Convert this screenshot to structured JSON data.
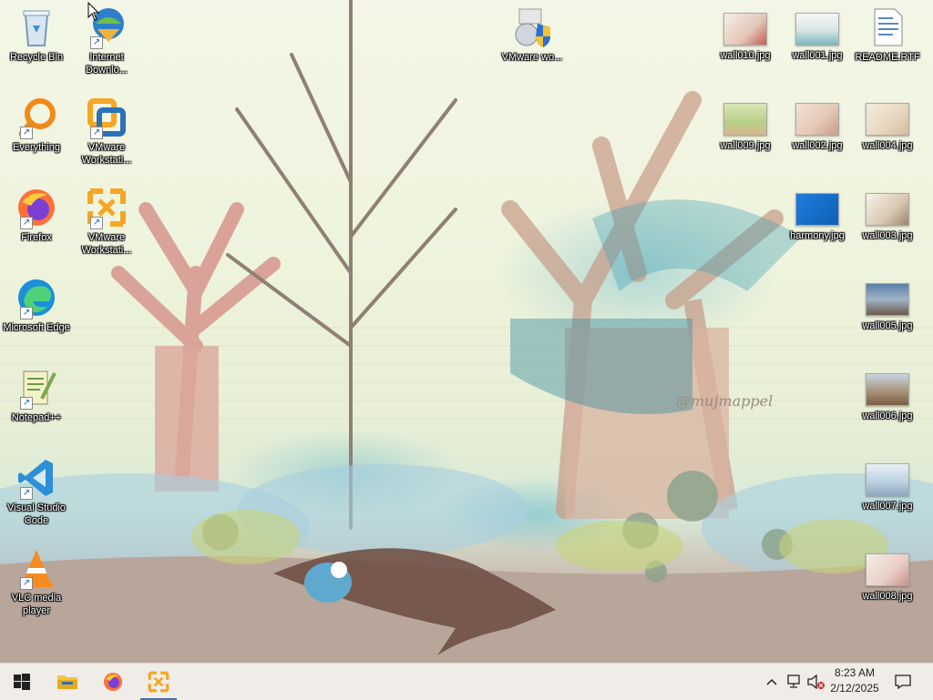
{
  "desktop": {
    "left_icons": [
      {
        "name": "recycle-bin",
        "label": "Recycle Bin"
      },
      {
        "name": "internet-download-manager",
        "label": "Internet Downlo..."
      },
      {
        "name": "everything",
        "label": "Everything"
      },
      {
        "name": "vmware-workstation-1",
        "label": "VMware Workstati..."
      },
      {
        "name": "firefox",
        "label": "Firefox"
      },
      {
        "name": "vmware-workstation-2",
        "label": "VMware Workstati..."
      },
      {
        "name": "microsoft-edge",
        "label": "Microsoft Edge"
      },
      {
        "name": "notepad-plus-plus",
        "label": "Notepad++"
      },
      {
        "name": "visual-studio-code",
        "label": "Visual Studio Code"
      },
      {
        "name": "vlc-media-player",
        "label": "VLC media player"
      }
    ],
    "center_icon": {
      "name": "vmware-wo",
      "label": "VMware wo..."
    },
    "right_icons": [
      {
        "name": "wall010",
        "label": "wall010.jpg"
      },
      {
        "name": "wall001",
        "label": "wall001.jpg"
      },
      {
        "name": "readme",
        "label": "README.RTF"
      },
      {
        "name": "wall009",
        "label": "wall009.jpg"
      },
      {
        "name": "wall002",
        "label": "wall002.jpg"
      },
      {
        "name": "wall004",
        "label": "wall004.jpg"
      },
      {
        "name": "harmony",
        "label": "harmony.jpg"
      },
      {
        "name": "wall003",
        "label": "wall003.jpg"
      },
      {
        "name": "wall005",
        "label": "wall005.jpg"
      },
      {
        "name": "wall006",
        "label": "wall006.jpg"
      },
      {
        "name": "wall007",
        "label": "wall007.jpg"
      },
      {
        "name": "wall008",
        "label": "wall008.jpg"
      }
    ],
    "wallpaper_signature": "@mujmappel"
  },
  "taskbar": {
    "start_icon": "windows-logo-icon",
    "pinned": [
      "file-explorer-icon",
      "firefox-icon",
      "vmware-icon"
    ],
    "tray_icons": [
      "chevron-up-icon",
      "network-icon",
      "volume-muted-icon",
      "notification-icon"
    ],
    "clock": {
      "time": "8:23 AM",
      "date": "2/12/2025"
    }
  },
  "colors": {
    "taskbar_bg": "#f0ece8",
    "accent": "#4a6fa5",
    "vmware_orange": "#f5a623",
    "vscode_blue": "#2d8fd6"
  }
}
